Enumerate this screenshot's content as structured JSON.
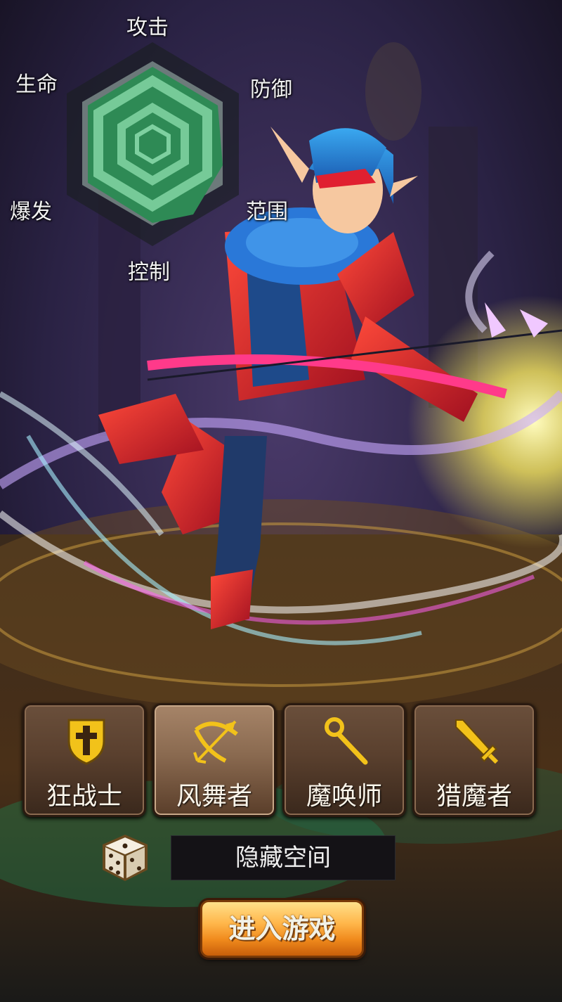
{
  "radar": {
    "labels": {
      "attack": "攻击",
      "defense": "防御",
      "range": "范围",
      "control": "控制",
      "burst": "爆发",
      "life": "生命"
    }
  },
  "classes": [
    {
      "label": "狂战士",
      "icon": "shield-cross-icon",
      "selected": false
    },
    {
      "label": "风舞者",
      "icon": "bow-arrow-icon",
      "selected": true
    },
    {
      "label": "魔唤师",
      "icon": "magic-staff-icon",
      "selected": false
    },
    {
      "label": "猎魔者",
      "icon": "sword-icon",
      "selected": false
    }
  ],
  "server": {
    "name": "隐藏空间"
  },
  "enter_button": {
    "label": "进入游戏"
  },
  "colors": {
    "radar_fill": "#2e8a55",
    "button_brown": "#5a402e",
    "button_selected": "#8a6a50",
    "enter_orange": "#f08a1c",
    "icon_gold": "#f2c21a"
  }
}
